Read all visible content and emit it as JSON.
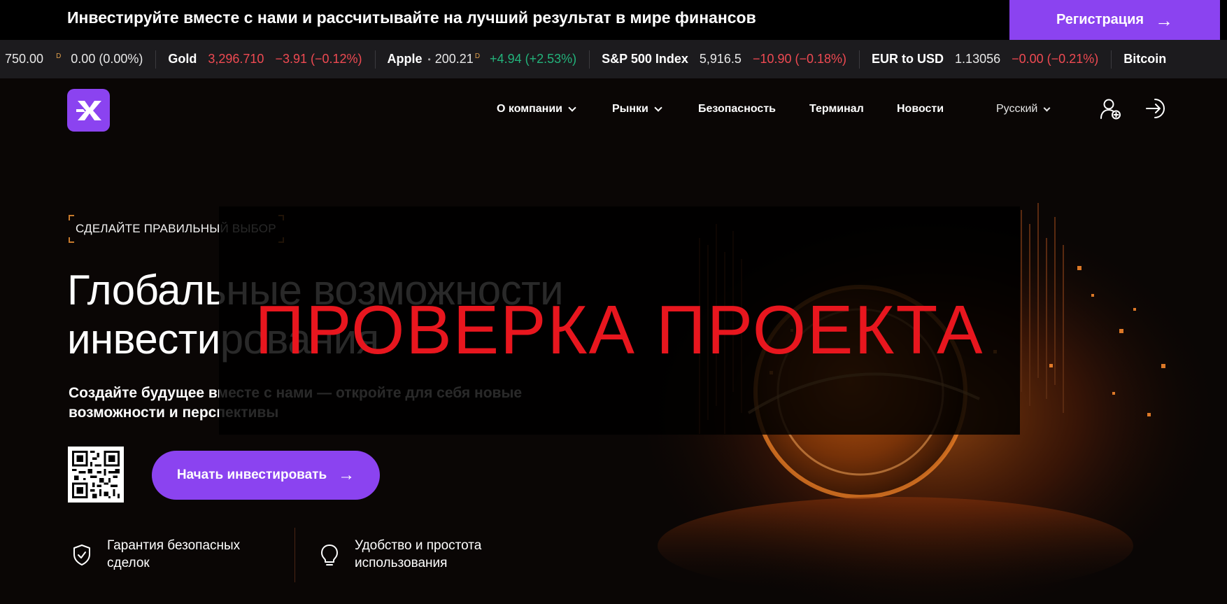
{
  "promo": {
    "text": "Инвестируйте вместе с нами и рассчитывайте на лучший результат в мире финансов",
    "button_label": "Регистрация",
    "button_arrow": "→"
  },
  "ticker": [
    {
      "name": "",
      "price": "750.00",
      "flag": "D",
      "change": "0.00 (0.00%)",
      "dir": "flat"
    },
    {
      "name": "Gold",
      "price": "3,296.710",
      "flag": "",
      "change": "−3.91 (−0.12%)",
      "dir": "down"
    },
    {
      "name": "Apple",
      "price": "200.21",
      "flag": "D",
      "change": "+4.94 (+2.53%)",
      "dir": "up"
    },
    {
      "name": "S&P 500 Index",
      "price": "5,916.5",
      "flag": "",
      "change": "−10.90 (−0.18%)",
      "dir": "down"
    },
    {
      "name": "EUR to USD",
      "price": "1.13056",
      "flag": "",
      "change": "−0.00 (−0.21%)",
      "dir": "down"
    },
    {
      "name": "Bitcoin",
      "price": "",
      "flag": "",
      "change": "",
      "dir": "flat"
    }
  ],
  "nav": {
    "items": [
      "О компании",
      "Рынки",
      "Безопасность",
      "Терминал",
      "Новости"
    ],
    "language": "Русский",
    "icons": [
      "user-add-icon",
      "login-icon"
    ]
  },
  "hero": {
    "eyebrow": "СДЕЛАЙТЕ ПРАВИЛЬНЫЙ ВЫБОР",
    "title_line1": "Глобальные возможности",
    "title_line2": "инвестирования",
    "subtitle": "Создайте будущее вместе с нами — откройте для себя новые возможности и перспективы",
    "cta_label": "Начать инвестировать",
    "cta_arrow": "→"
  },
  "features": [
    {
      "icon": "shield-check-icon",
      "text": "Гарантия безопасных сделок"
    },
    {
      "icon": "lightbulb-icon",
      "text": "Удобство и простота использования"
    }
  ],
  "watermark": {
    "text": "ПРОВЕРКА ПРОЕКТА"
  },
  "colors": {
    "accent": "#8b43f0",
    "down": "#ef4a52",
    "up": "#23b37b",
    "watermark": "#e8161e",
    "background": "#0a0605"
  }
}
